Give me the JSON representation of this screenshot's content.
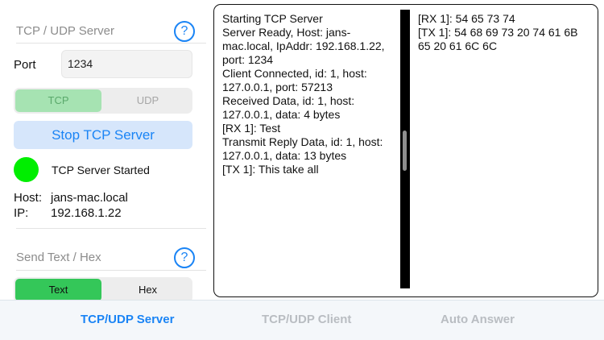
{
  "server_section": {
    "title": "TCP / UDP Server",
    "help_icon": "?",
    "port_label": "Port",
    "port_value": "1234",
    "protocol_options": [
      "TCP",
      "UDP"
    ],
    "protocol_selected": "TCP",
    "stop_button_label": "Stop TCP Server",
    "status_text": "TCP Server Started",
    "status_color": "#00ee00",
    "host_label": "Host:",
    "host_value": "jans-mac.local",
    "ip_label": "IP:",
    "ip_value": "192.168.1.22"
  },
  "send_section": {
    "title": "Send Text / Hex",
    "help_icon": "?",
    "format_options": [
      "Text",
      "Hex"
    ],
    "format_selected": "Text"
  },
  "log": {
    "left_lines": [
      "Starting TCP Server",
      "Server Ready, Host: jans-mac.local, IpAddr: 192.168.1.22, port: 1234",
      "Client Connected, id: 1, host: 127.0.0.1, port: 57213",
      "Received Data, id: 1, host: 127.0.0.1, data: 4 bytes",
      "[RX 1]: Test",
      "Transmit Reply Data, id: 1, host: 127.0.0.1, data: 13 bytes",
      "[TX 1]: This take all"
    ],
    "right_lines": [
      "[RX 1]: 54 65 73 74",
      "[TX 1]: 54 68 69 73 20 74 61 6B 65 20 61 6C 6C"
    ]
  },
  "tabs": [
    {
      "label": "TCP/UDP Server",
      "active": true
    },
    {
      "label": "TCP/UDP Client",
      "active": false
    },
    {
      "label": "Auto Answer",
      "active": false
    }
  ],
  "colors": {
    "accent": "#1a84f5",
    "selected_green": "#34c759",
    "selected_green_light": "#a6e3b2"
  }
}
